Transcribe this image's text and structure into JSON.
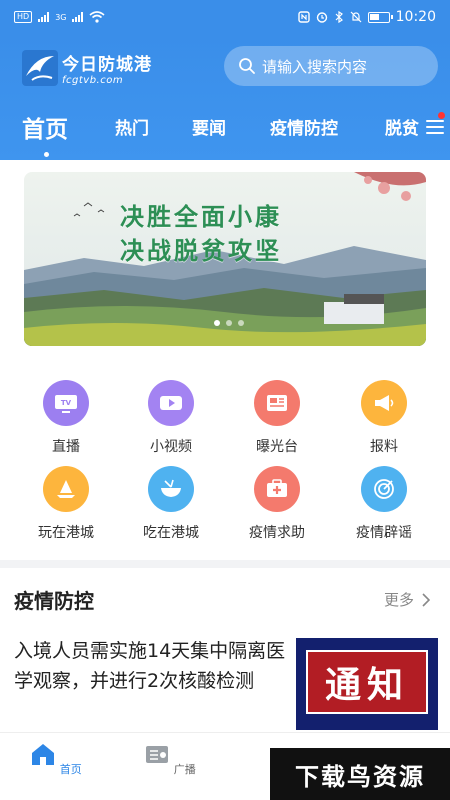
{
  "status_bar": {
    "sim_badge": "HD",
    "network_label": "4G",
    "network_label2": "3G",
    "time": "10:20"
  },
  "header": {
    "logo_title": "今日防城港",
    "logo_subtitle": "fcgtvb.com",
    "search_placeholder": "请输入搜索内容"
  },
  "tabs": [
    {
      "label": "首页",
      "active": true
    },
    {
      "label": "热门",
      "active": false
    },
    {
      "label": "要闻",
      "active": false
    },
    {
      "label": "疫情防控",
      "active": false
    },
    {
      "label": "脱贫",
      "active": false
    }
  ],
  "banner": {
    "line1": "决胜全面小康",
    "line2": "决战脱贫攻坚",
    "dots": 3,
    "active_dot": 0
  },
  "grid": [
    {
      "label": "直播",
      "icon": "tv-icon",
      "color": "#9c7ff0"
    },
    {
      "label": "小视频",
      "icon": "video-icon",
      "color": "#a383f2"
    },
    {
      "label": "曝光台",
      "icon": "exposure-icon",
      "color": "#f47a6d"
    },
    {
      "label": "报料",
      "icon": "megaphone-icon",
      "color": "#fdb53d"
    },
    {
      "label": "玩在港城",
      "icon": "sailboat-icon",
      "color": "#fdb53d"
    },
    {
      "label": "吃在港城",
      "icon": "bowl-icon",
      "color": "#4fb2f0"
    },
    {
      "label": "疫情求助",
      "icon": "medical-kit-icon",
      "color": "#f47a6d"
    },
    {
      "label": "疫情辟谣",
      "icon": "target-icon",
      "color": "#4fb2f0"
    }
  ],
  "section": {
    "title": "疫情防控",
    "more": "更多"
  },
  "news": [
    {
      "title": "入境人员需实施14天集中隔离医学观察，并进行2次核酸检测",
      "thumb_text": "通知"
    }
  ],
  "bottom_nav": [
    {
      "label": "首页",
      "icon": "home-icon",
      "active": true
    },
    {
      "label": "广播",
      "icon": "radio-icon",
      "active": false
    }
  ],
  "watermark": "下载鸟资源",
  "colors": {
    "primary": "#3a8ee9",
    "active_nav": "#2d86e6"
  }
}
